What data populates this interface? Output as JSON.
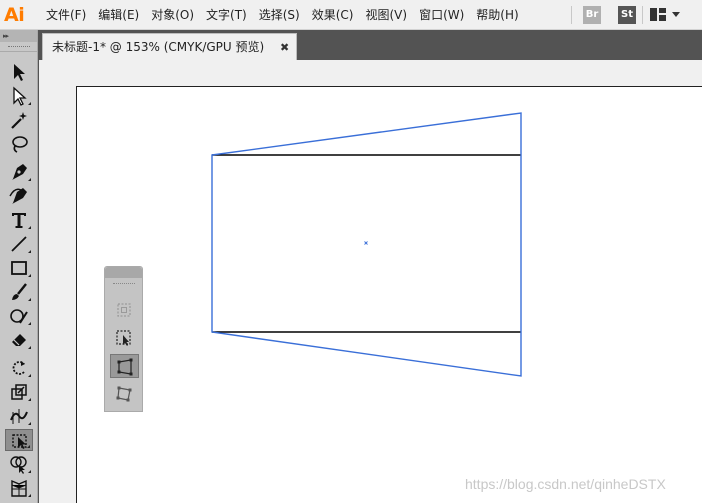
{
  "app": {
    "logo": "Ai"
  },
  "menu": [
    "文件(F)",
    "编辑(E)",
    "对象(O)",
    "文字(T)",
    "选择(S)",
    "效果(C)",
    "视图(V)",
    "窗口(W)",
    "帮助(H)"
  ],
  "menu_right": {
    "br_label": "Br",
    "st_label": "St"
  },
  "document": {
    "tab_title": "未标题-1* @ 153% (CMYK/GPU 预览)",
    "close_glyph": "✖"
  },
  "tools_panel": {
    "collapse_glyph": "▸▸"
  },
  "watermark": "https://blog.csdn.net/qinheDSTX",
  "colors": {
    "accent": "#ff7c00",
    "selection": "#3a6fd8",
    "path": "#000000",
    "canvas": "#f0f0f0",
    "chrome": "#535353"
  },
  "icons": {
    "tools": [
      "selection-tool-icon",
      "direct-selection-tool-icon",
      "magic-wand-tool-icon",
      "lasso-tool-icon",
      "pen-tool-icon",
      "curvature-tool-icon",
      "type-tool-icon",
      "line-segment-tool-icon",
      "rectangle-tool-icon",
      "paintbrush-tool-icon",
      "shaper-tool-icon",
      "eraser-tool-icon",
      "rotate-tool-icon",
      "scale-tool-icon",
      "width-tool-icon",
      "free-transform-tool-icon",
      "shape-builder-tool-icon",
      "perspective-grid-tool-icon"
    ],
    "free_transform_widget": [
      "constrain-icon",
      "free-transform-icon",
      "perspective-distort-icon",
      "free-distort-icon"
    ]
  }
}
